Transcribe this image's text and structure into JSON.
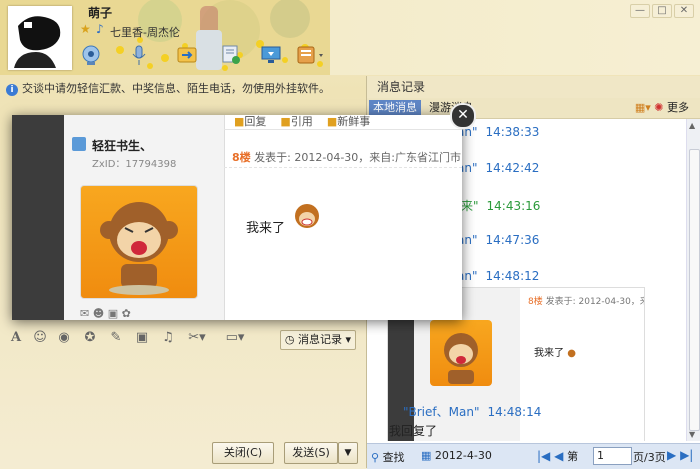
{
  "window": {
    "contact_name": "萌子",
    "signature": "七里香-周杰伦",
    "warning_text": "交谈中请勿轻信汇款、中奖信息、陌生电话，勿使用外挂软件。",
    "controls": [
      "—",
      "□",
      "✕"
    ]
  },
  "toolbar_icons": [
    "video-call-icon",
    "voice-call-icon",
    "send-file-icon",
    "remote-assist-icon",
    "screen-share-icon",
    "app-menu-icon"
  ],
  "input_toolbar": {
    "icons": [
      "font-icon",
      "emoji-icon",
      "vibrate-icon",
      "magic-icon",
      "edit-icon",
      "image-icon",
      "music-icon",
      "scissors-icon",
      "folder-icon"
    ],
    "record_button": "消息记录"
  },
  "buttons": {
    "close": "关闭(C)",
    "send": "发送(S)"
  },
  "history": {
    "title": "消息记录",
    "tabs": [
      "本地消息",
      "漫游消息"
    ],
    "more": "更多",
    "rows": [
      {
        "prefix": "an\"",
        "time": "14:38:33"
      },
      {
        "prefix": "an\"",
        "time": "14:42:42"
      },
      {
        "prefix": "来\"",
        "time": "14:43:16"
      },
      {
        "prefix": "an\"",
        "time": "14:47:36"
      },
      {
        "prefix": "an\"",
        "time": "14:48:12"
      }
    ],
    "post_floor": "8楼",
    "post_meta": "发表于: 2012-04-30，来自:广东省江门市",
    "post_msg": "我来了",
    "last_sender": "\"Brief、Man\"",
    "last_time": "14:48:14",
    "last_msg": "我回复了",
    "footer": {
      "search": "查找",
      "date": "2012-4-30",
      "page_label": "第",
      "page_value": "1",
      "page_total": "页/3页"
    }
  },
  "popup": {
    "actions": [
      "回复",
      "引用",
      "新鲜事"
    ],
    "user": "轻狂书生、",
    "zxid": "ZxID：17794398",
    "floor": "8楼",
    "meta": "发表于: 2012-04-30，来自:广东省江门市",
    "message": "我来了",
    "close": "✕"
  },
  "colors": {
    "accent": "#2a6ec2",
    "floor": "#e8702a",
    "green_time": "#2a9a3a"
  }
}
